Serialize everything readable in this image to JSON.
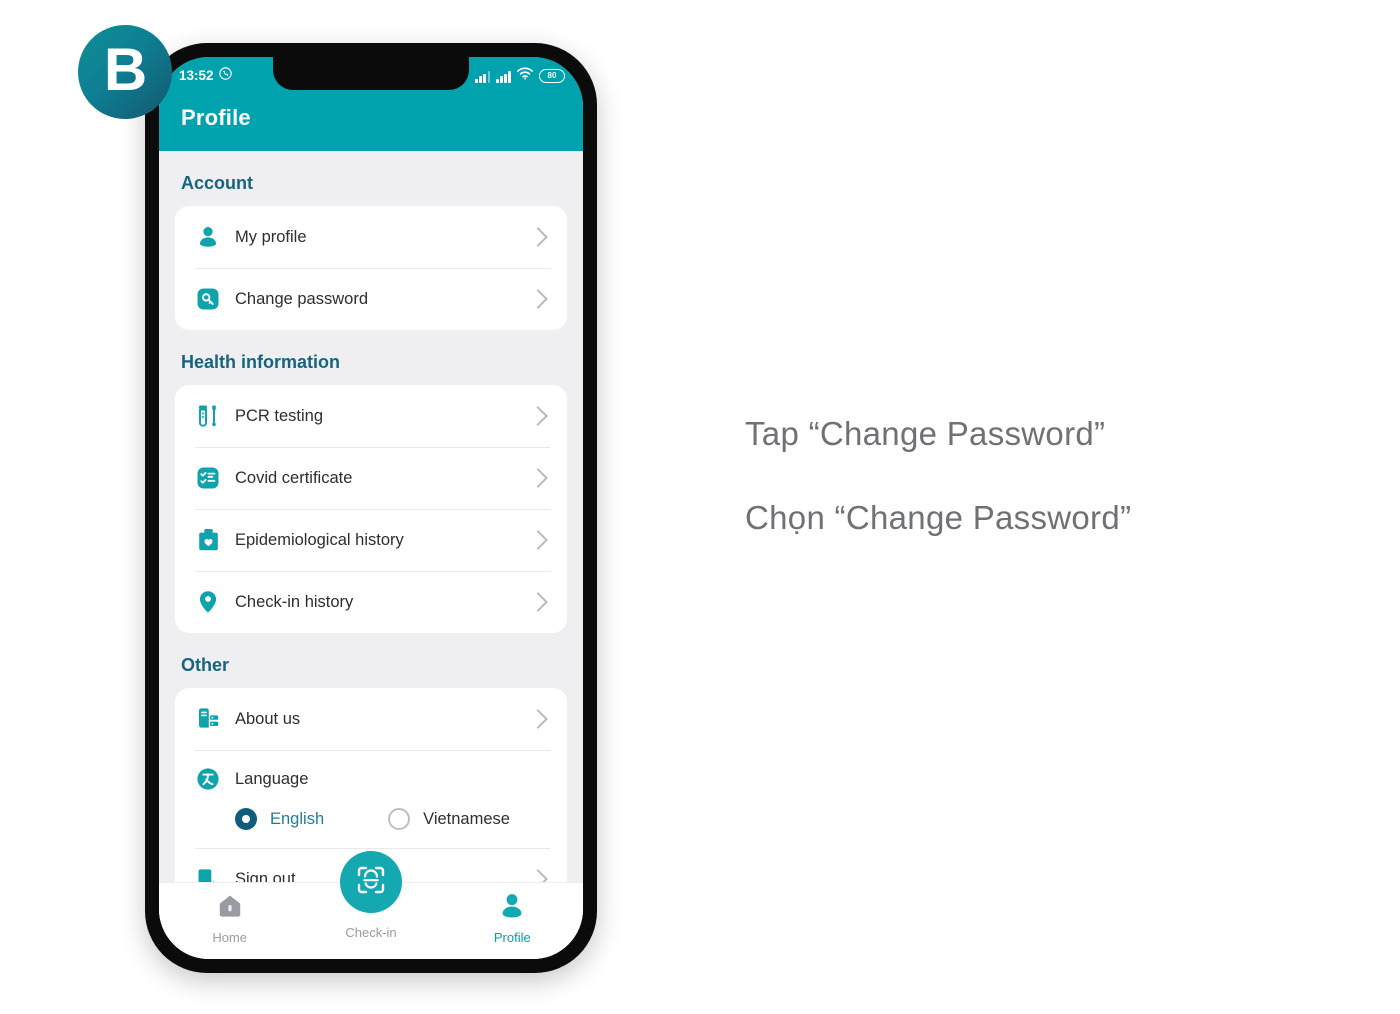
{
  "logo": {
    "letter": "B"
  },
  "phone": {
    "statusbar": {
      "time": "13:52",
      "time_icon": "call-bubble-icon",
      "signal_icon_1": "cellular-signal-icon",
      "signal_icon_2": "cellular-signal-icon",
      "wifi_icon": "wifi-icon",
      "battery_level": "80"
    },
    "appbar": {
      "title": "Profile"
    },
    "sections": [
      {
        "title": "Account",
        "items": [
          {
            "label": "My profile",
            "icon": "person-icon",
            "chevron": true
          },
          {
            "label": "Change password",
            "icon": "key-icon",
            "chevron": true
          }
        ]
      },
      {
        "title": "Health information",
        "items": [
          {
            "label": "PCR testing",
            "icon": "test-tube-icon",
            "chevron": true
          },
          {
            "label": "Covid certificate",
            "icon": "checklist-icon",
            "chevron": true
          },
          {
            "label": "Epidemiological history",
            "icon": "clipboard-heart-icon",
            "chevron": true
          },
          {
            "label": "Check-in history",
            "icon": "map-pin-icon",
            "chevron": true
          }
        ]
      },
      {
        "title": "Other",
        "items": [
          {
            "label": "About us",
            "icon": "document-info-icon",
            "chevron": true
          },
          {
            "label": "Language",
            "icon": "translate-icon",
            "chevron": false
          },
          {
            "label": "Sign out",
            "icon": "sign-out-icon",
            "chevron": true
          }
        ]
      }
    ],
    "language": {
      "options": [
        {
          "label": "English",
          "selected": true
        },
        {
          "label": "Vietnamese",
          "selected": false
        }
      ]
    },
    "bottom_nav": [
      {
        "label": "Home",
        "icon": "home-icon",
        "active": false
      },
      {
        "label": "Check-in",
        "icon": "face-scan-icon",
        "active": false
      },
      {
        "label": "Profile",
        "icon": "person-icon",
        "active": true
      }
    ]
  },
  "instructions": {
    "line_en": "Tap “Change Password”",
    "line_vi": "Chọn “Change Password”"
  },
  "colors": {
    "teal": "#00a3ad",
    "teal_icon": "#0fa3ac",
    "section_header": "#16647f",
    "radio_selected": "#0f5c7c",
    "text": "#2d2d33",
    "instruction_text": "#6f7174"
  }
}
